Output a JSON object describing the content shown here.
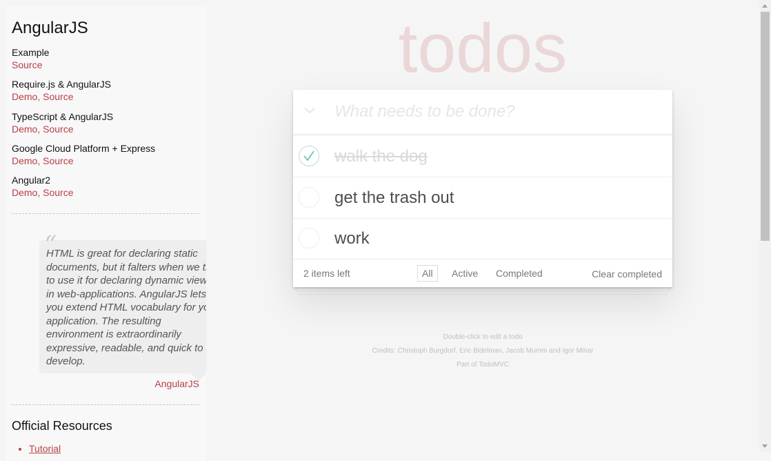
{
  "sidebar": {
    "title": "AngularJS",
    "examples": [
      {
        "name": "Example",
        "links": [
          "Source"
        ]
      },
      {
        "name": "Require.js & AngularJS",
        "links": [
          "Demo",
          "Source"
        ]
      },
      {
        "name": "TypeScript & AngularJS",
        "links": [
          "Demo",
          "Source"
        ]
      },
      {
        "name": "Google Cloud Platform + Express",
        "links": [
          "Demo",
          "Source"
        ]
      },
      {
        "name": "Angular2",
        "links": [
          "Demo",
          "Source"
        ]
      }
    ],
    "link_separator": ", ",
    "quote": {
      "text": "HTML is great for declaring static documents, but it falters when we try to use it for declaring dynamic views in web-applications. AngularJS lets you extend HTML vocabulary for your application. The resulting environment is extraordinarily expressive, readable, and quick to develop.",
      "source": "AngularJS",
      "open_mark": "“",
      "close_mark": "”"
    },
    "resources_title": "Official Resources",
    "resources": [
      "Tutorial"
    ]
  },
  "app": {
    "title": "todos",
    "new_todo_placeholder": "What needs to be done?",
    "new_todo_value": "",
    "todos": [
      {
        "title": "walk the dog",
        "completed": true
      },
      {
        "title": "get the trash out",
        "completed": false
      },
      {
        "title": "work",
        "completed": false
      }
    ],
    "footer": {
      "count": "2 items left",
      "filters": [
        "All",
        "Active",
        "Completed"
      ],
      "selected_filter": "All",
      "clear_completed": "Clear completed"
    }
  },
  "info": {
    "edit_hint": "Double-click to edit a todo",
    "credits": "Credits: Christoph Burgdorf, Eric Bidelman, Jacob Mumm and Igor Minar",
    "part_of": "Part of TodoMVC"
  },
  "colors": {
    "accent": "#b83f45",
    "check": "#5dc2af",
    "background": "#f5f5f5"
  },
  "icons": {
    "toggle_all": "chevron-down-icon",
    "completed_check": "checkmark-icon"
  }
}
